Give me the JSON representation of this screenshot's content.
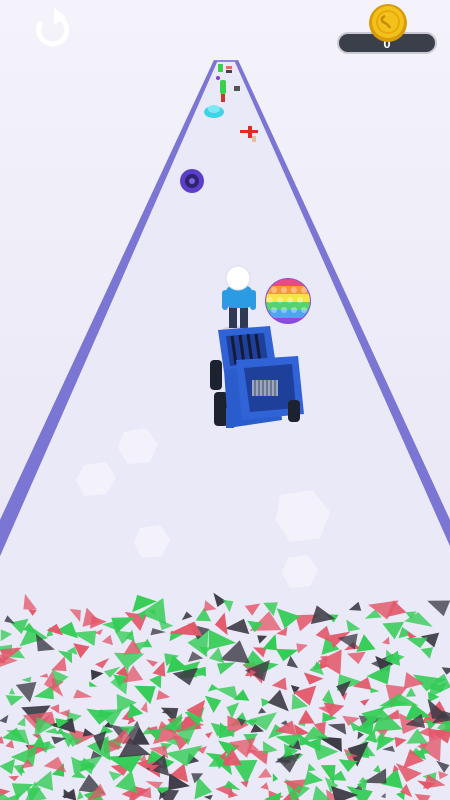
{
  "hud": {
    "restart_icon": "restart-arrow-icon",
    "coin_icon": "coin-icon",
    "coin_count": "0"
  },
  "colors": {
    "track": "#e9e8f6",
    "track_border": "#8b86dc",
    "shredder": "#2f63d6",
    "player_shirt": "#2b9be3",
    "shard_green": "#33cc55",
    "shard_red": "#e2586a",
    "shard_dark": "#3d3b45",
    "coin": "#f3c21a"
  },
  "scene": {
    "objects": [
      "pop-it-toy",
      "purple-tire",
      "cyan-jelly",
      "red-toy-plane",
      "green-bottle",
      "player",
      "blue-shredder",
      "shredded-debris-pile"
    ]
  }
}
